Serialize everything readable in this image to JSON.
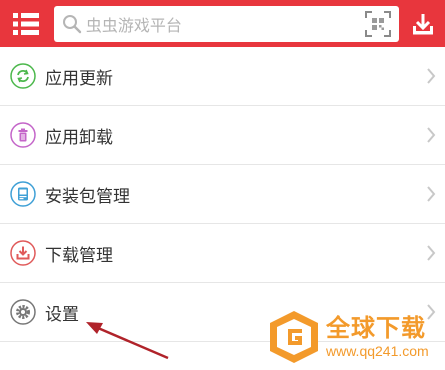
{
  "topbar": {
    "menu_icon": "menu-icon",
    "search": {
      "placeholder": "虫虫游戏平台",
      "icon": "search-icon",
      "qr_icon": "qr-scan-icon"
    },
    "download_icon": "download-icon",
    "bg_color": "#e8363d"
  },
  "menu": {
    "items": [
      {
        "label": "应用更新",
        "icon": "refresh-icon",
        "color": "#4cb84c"
      },
      {
        "label": "应用卸载",
        "icon": "trash-icon",
        "color": "#c466c9"
      },
      {
        "label": "安装包管理",
        "icon": "package-icon",
        "color": "#3fa0d6"
      },
      {
        "label": "下载管理",
        "icon": "download-icon",
        "color": "#e05a5a"
      },
      {
        "label": "设置",
        "icon": "gear-icon",
        "color": "#777777"
      }
    ]
  },
  "annotation": {
    "arrow_color": "#b0232a"
  },
  "watermark": {
    "title": "全球下载",
    "url": "www.qq241.com",
    "color": "#f39a2b"
  }
}
